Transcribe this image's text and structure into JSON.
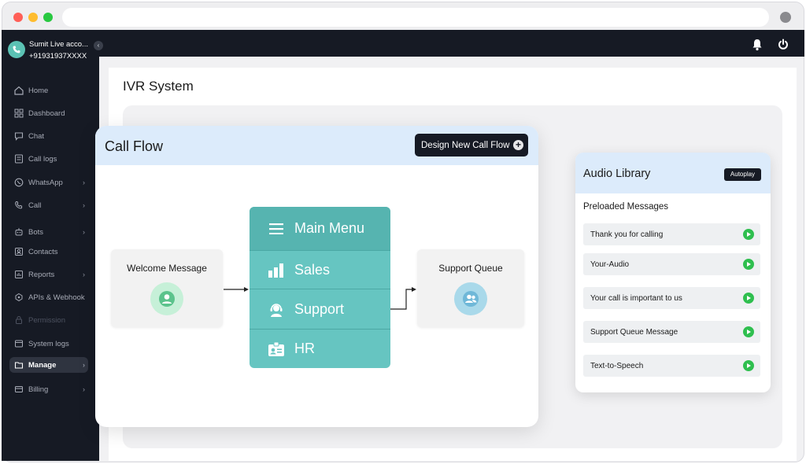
{
  "window": {
    "traffic_light_colors": [
      "#ff5f57",
      "#febc2e",
      "#28c840"
    ]
  },
  "account": {
    "name": "Sumit Live acco...",
    "phone": "+91931937XXXX",
    "collapse_glyph": "‹"
  },
  "sidebar": {
    "items": [
      {
        "label": "Home",
        "icon": "home-icon"
      },
      {
        "label": "Dashboard",
        "icon": "grid-icon"
      },
      {
        "label": "Chat",
        "icon": "chat-bubble-icon"
      },
      {
        "label": "Call logs",
        "icon": "log-icon"
      },
      {
        "label": "WhatsApp",
        "icon": "whatsapp-icon",
        "chevron": "›"
      },
      {
        "label": "Call",
        "icon": "phone-icon",
        "chevron": "›"
      },
      {
        "label": "Bots",
        "icon": "bot-icon",
        "chevron": "›"
      },
      {
        "label": "Contacts",
        "icon": "contacts-icon"
      },
      {
        "label": "Reports",
        "icon": "reports-icon",
        "chevron": "›"
      },
      {
        "label": "APIs & Webhook",
        "icon": "api-icon"
      },
      {
        "label": "Permission",
        "icon": "lock-icon",
        "disabled": true
      },
      {
        "label": "System logs",
        "icon": "system-logs-icon"
      },
      {
        "label": "Manage",
        "icon": "folder-icon",
        "chevron": "›",
        "active": true
      },
      {
        "label": "Billing",
        "icon": "billing-icon",
        "chevron": "›"
      }
    ]
  },
  "page": {
    "title": "IVR System"
  },
  "call_flow": {
    "title": "Call Flow",
    "design_button": "Design New Call Flow",
    "design_plus": "+",
    "welcome": {
      "label": "Welcome Message"
    },
    "support_queue": {
      "label": "Support Queue"
    },
    "menu": [
      {
        "label": "Main Menu",
        "icon": "hamburger-icon"
      },
      {
        "label": "Sales",
        "icon": "bar-chart-icon"
      },
      {
        "label": "Support",
        "icon": "headset-icon"
      },
      {
        "label": "HR",
        "icon": "id-badge-icon"
      }
    ]
  },
  "audio_library": {
    "title": "Audio Library",
    "autoplay_label": "Autoplay",
    "section_label": "Preloaded Messages",
    "tracks": [
      "Thank you for calling",
      "Your-Audio",
      "Your call is important to us",
      "Support Queue Message",
      "Text-to-Speech"
    ]
  },
  "colors": {
    "sidebar_bg": "#161a24",
    "accent_teal": "#66c5c1",
    "header_blue": "#dcebfb",
    "play_green": "#2fbf4f"
  }
}
